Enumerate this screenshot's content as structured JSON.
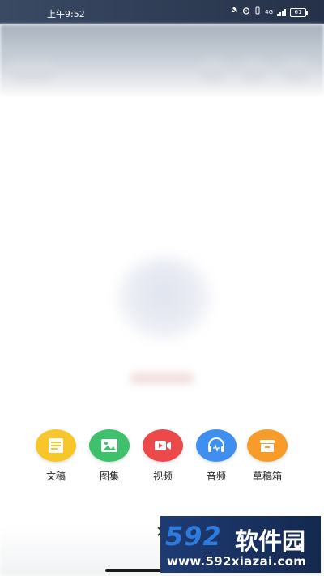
{
  "status_bar": {
    "time": "上午9:52",
    "network": "4G",
    "battery": "61",
    "icons": [
      "bell-muted-icon",
      "alarm-icon",
      "vibrate-icon",
      "signal-icon",
      "battery-icon"
    ]
  },
  "publish_menu": {
    "items": [
      {
        "label": "文稿",
        "icon": "document-icon",
        "color": "#f7c62b"
      },
      {
        "label": "图集",
        "icon": "image-icon",
        "color": "#3fc06d"
      },
      {
        "label": "视频",
        "icon": "video-icon",
        "color": "#ec4a4a"
      },
      {
        "label": "音频",
        "icon": "headphones-icon",
        "color": "#3f8ff0"
      },
      {
        "label": "草稿箱",
        "icon": "drafts-box-icon",
        "color": "#f79b2b"
      }
    ]
  },
  "close_icon": "close-icon",
  "watermark": {
    "brand_number": "592",
    "brand_text": "软件园",
    "url": "www.592xiazai.com"
  }
}
